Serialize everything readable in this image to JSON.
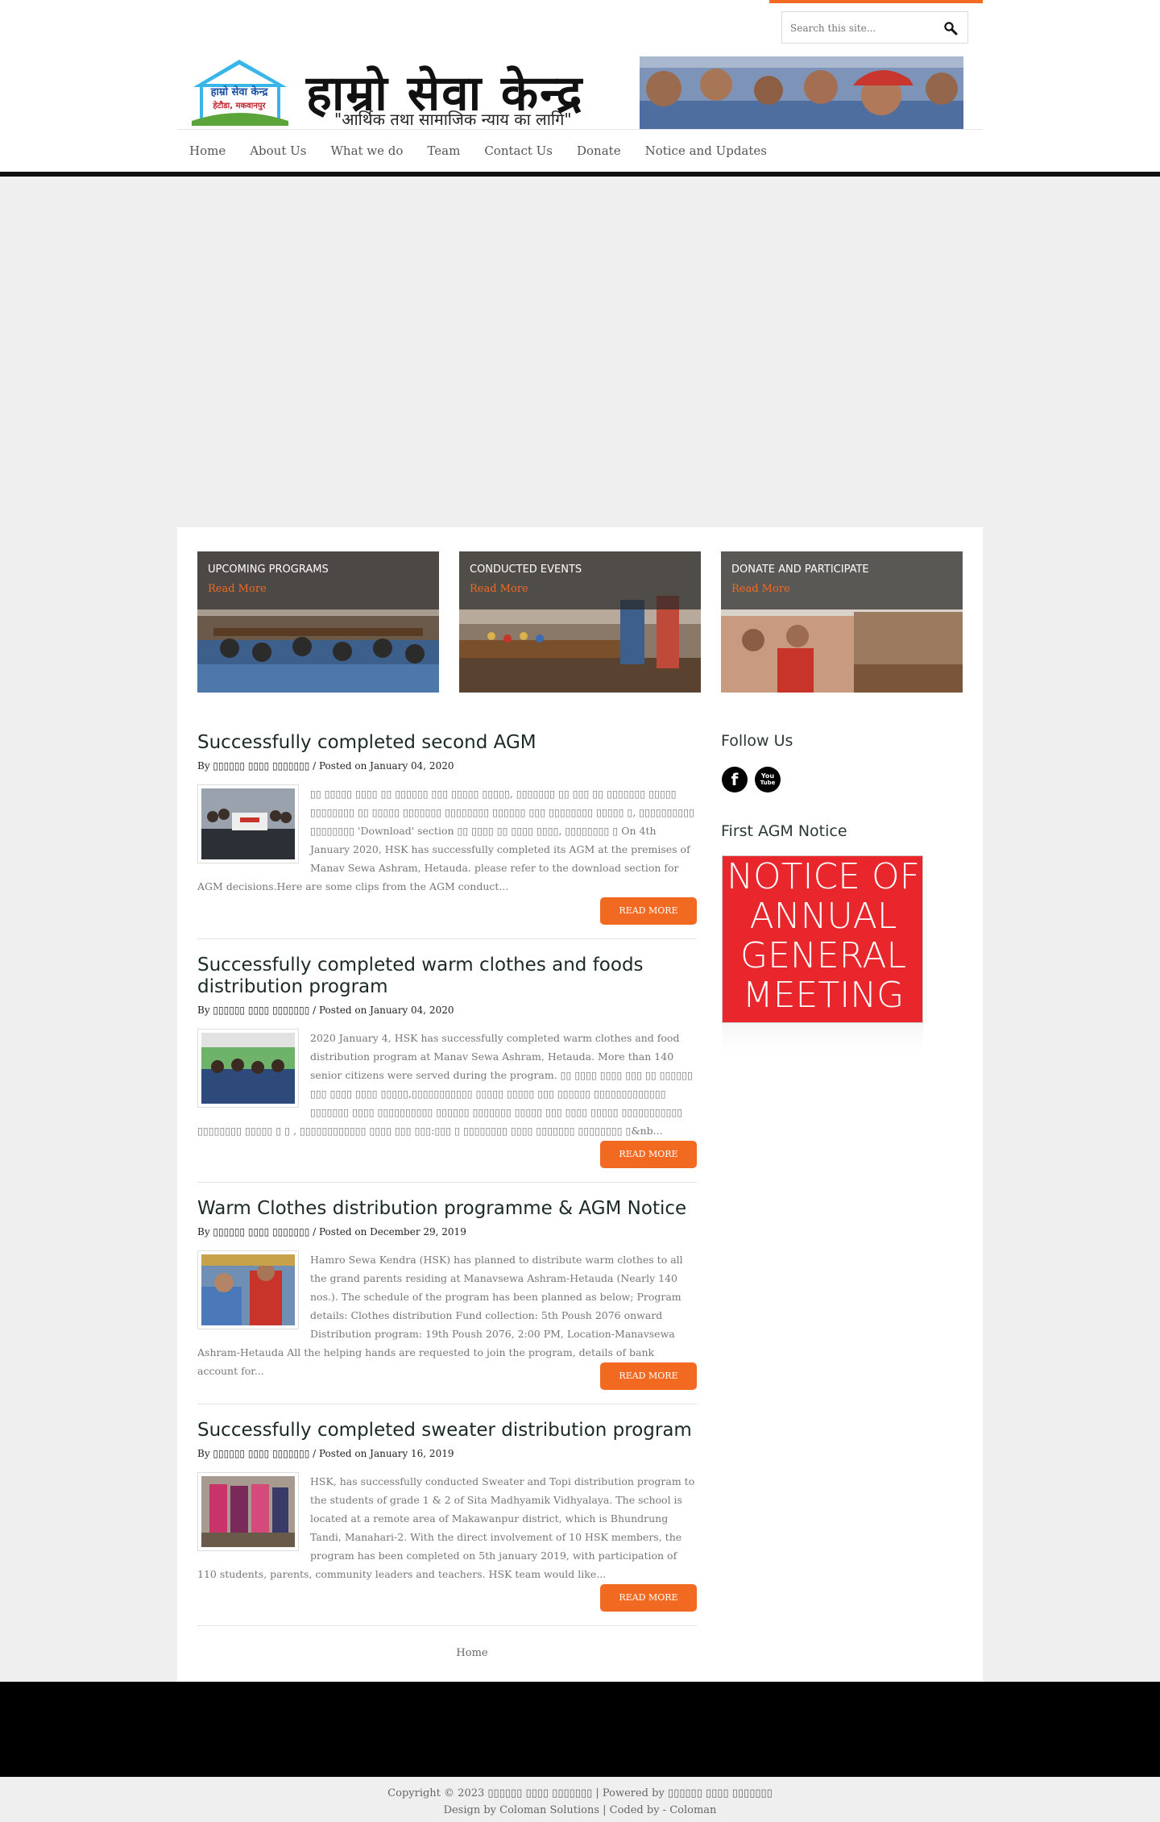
{
  "search": {
    "placeholder": "Search this site..."
  },
  "logo": {
    "house_line1": "हाम्रो सेवा केन्द्र",
    "house_line2": "हेटौडा, मकवानपुर",
    "title": "हाम्रो सेवा केन्द्र",
    "tagline": "\"आर्थिक तथा सामाजिक न्याय का लागि\""
  },
  "nav": [
    {
      "label": "Home"
    },
    {
      "label": "About Us"
    },
    {
      "label": "What we do"
    },
    {
      "label": "Team"
    },
    {
      "label": "Contact Us"
    },
    {
      "label": "Donate"
    },
    {
      "label": "Notice and Updates"
    }
  ],
  "features": [
    {
      "title": "UPCOMING PROGRAMS",
      "link": "Read More"
    },
    {
      "title": "CONDUCTED EVENTS",
      "link": "Read More"
    },
    {
      "title": "DONATE AND PARTICIPATE",
      "link": "Read More"
    }
  ],
  "posts": [
    {
      "title": "Successfully completed second AGM",
      "meta": "By ▯▯▯▯▯▯ ▯▯▯▯ ▯▯▯▯▯▯▯ / Posted on January 04, 2020",
      "excerpt": "▯▯ ▯▯▯▯▯ ▯▯▯▯ ▯▯ ▯▯▯▯▯▯ ▯▯▯ ▯▯▯▯▯ ▯▯▯▯▯, ▯▯▯▯▯▯▯ ▯▯ ▯▯▯ ▯▯ ▯▯▯▯▯▯▯ ▯▯▯▯▯ ▯▯▯▯▯▯▯▯ ▯▯ ▯▯▯▯▯ ▯▯▯▯▯▯▯ ▯▯▯▯▯▯▯▯ ▯▯▯▯▯▯ ▯▯▯ ▯▯▯▯▯▯▯▯ ▯▯▯▯▯ ▯, ▯▯▯▯▯▯▯▯▯▯ ▯▯▯▯▯▯▯▯ 'Download' section ▯▯ ▯▯▯▯ ▯▯ ▯▯▯▯ ▯▯▯▯, ▯▯▯▯▯▯▯▯ ▯ On 4th January 2020, HSK has successfully completed its AGM at the premises of Manav Sewa Ashram, Hetauda. please refer to the download section for AGM decisions.Here are some clips from the AGM conduct...",
      "button": "READ MORE"
    },
    {
      "title": "Successfully completed warm clothes and foods distribution program",
      "meta": "By ▯▯▯▯▯▯ ▯▯▯▯ ▯▯▯▯▯▯▯ / Posted on January 04, 2020",
      "excerpt": "2020 January 4, HSK has successfully completed warm clothes and food distribution program at Manav Sewa Ashram, Hetauda. More than 140 senior citizens were served during the program. ▯▯ ▯▯▯▯ ▯▯▯▯ ▯▯▯ ▯▯ ▯▯▯▯▯▯ ▯▯▯ ▯▯▯▯ ▯▯▯▯ ▯▯▯▯▯,▯▯▯▯▯▯▯▯▯▯▯ ▯▯▯▯▯ ▯▯▯▯▯ ▯▯▯ ▯▯▯▯▯▯ ▯▯▯▯▯▯▯▯▯▯▯▯▯ ▯▯▯▯▯▯▯ ▯▯▯▯ ▯▯▯▯▯▯▯▯▯▯ ▯▯▯▯▯▯ ▯▯▯▯▯▯▯ ▯▯▯▯▯ ▯▯▯ ▯▯▯▯ ▯▯▯▯▯ ▯▯▯▯▯▯▯▯▯▯▯ ▯▯▯▯▯▯▯▯ ▯▯▯▯▯ ▯ ▯ , ▯▯▯▯▯▯▯▯▯▯▯▯ ▯▯▯▯ ▯▯▯ ▯▯▯:▯▯▯ ▯ ▯▯▯▯▯▯▯▯ ▯▯▯▯ ▯▯▯▯▯▯▯ ▯▯▯▯▯▯▯▯ ▯&nb...",
      "button": "READ MORE"
    },
    {
      "title": "Warm Clothes distribution programme & AGM Notice",
      "meta": "By ▯▯▯▯▯▯ ▯▯▯▯ ▯▯▯▯▯▯▯ / Posted on December 29, 2019",
      "excerpt": "Hamro Sewa Kendra (HSK) has planned to distribute warm clothes to all the grand parents residing at Manavsewa Ashram-Hetauda (Nearly 140 nos.). The schedule of the program has been planned as below; Program details: Clothes distribution Fund collection: 5th Poush 2076 onward Distribution program: 19th Poush 2076, 2:00 PM, Location-Manavsewa Ashram-Hetauda All the helping hands are requested to join the program, details of bank account for...",
      "button": "READ MORE"
    },
    {
      "title": "Successfully completed sweater distribution program",
      "meta": "By ▯▯▯▯▯▯ ▯▯▯▯ ▯▯▯▯▯▯▯ / Posted on January 16, 2019",
      "excerpt": "HSK, has successfully conducted Sweater and Topi distribution program to the students of grade 1 & 2 of Sita Madhyamik Vidhyalaya. The school is located at a remote area of Makawanpur district, which is Bhundrung Tandi, Manahari-2. With the direct involvement of 10  HSK members, the program has been completed on 5th january 2019, with participation of 110 students, parents, community leaders and teachers. HSK team would like...",
      "button": "READ MORE"
    }
  ],
  "sidebar": {
    "follow_title": "Follow Us",
    "facebook": "f",
    "youtube_1": "You",
    "youtube_2": "Tube",
    "agm_title": "First AGM Notice",
    "agm_lines": [
      "NOTICE OF",
      "ANNUAL",
      "GENERAL",
      "MEETING"
    ]
  },
  "pager": {
    "home": "Home"
  },
  "footer": {
    "line1": "Copyright © 2023 ▯▯▯▯▯▯ ▯▯▯▯ ▯▯▯▯▯▯▯ | Powered by ▯▯▯▯▯▯ ▯▯▯▯ ▯▯▯▯▯▯▯",
    "line2": "Design by Coloman Solutions | Coded by - Coloman"
  },
  "colors": {
    "accent": "#f26a21",
    "title": "#1b2a24",
    "agm_red": "#e8262b"
  },
  "icons": [
    "search-icon",
    "facebook-icon",
    "youtube-icon"
  ]
}
